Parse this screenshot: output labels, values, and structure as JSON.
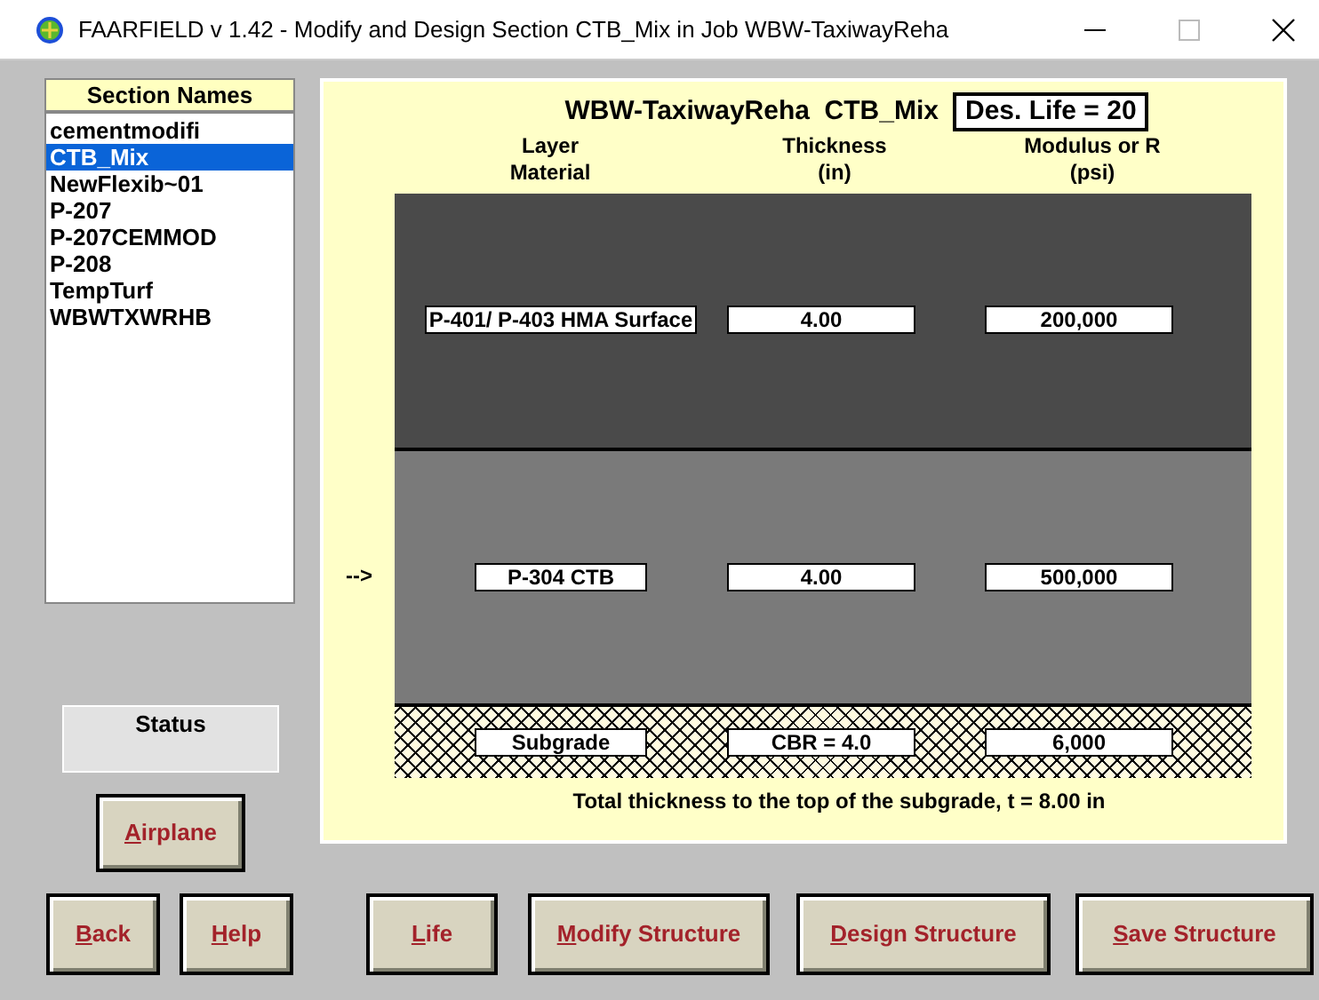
{
  "window": {
    "title": "FAARFIELD v 1.42 - Modify and Design Section CTB_Mix in Job WBW-TaxiwayReha"
  },
  "section_names": {
    "header": "Section Names",
    "items": [
      {
        "label": "cementmodifi",
        "selected": false
      },
      {
        "label": "CTB_Mix",
        "selected": true
      },
      {
        "label": "NewFlexib~01",
        "selected": false
      },
      {
        "label": "P-207",
        "selected": false
      },
      {
        "label": "P-207CEMMOD",
        "selected": false
      },
      {
        "label": "P-208",
        "selected": false
      },
      {
        "label": "TempTurf",
        "selected": false
      },
      {
        "label": "WBWTXWRHB",
        "selected": false
      }
    ]
  },
  "status": {
    "label": "Status"
  },
  "airplane_button": {
    "accel": "A",
    "rest": "irplane"
  },
  "structure": {
    "job": "WBW-TaxiwayReha",
    "section": "CTB_Mix",
    "design_life": "Des. Life = 20",
    "columns": [
      {
        "line1": "Layer",
        "line2": "Material"
      },
      {
        "line1": "Thickness",
        "line2": "(in)"
      },
      {
        "line1": "Modulus or R",
        "line2": "(psi)"
      }
    ],
    "layers": [
      {
        "kind": "surface",
        "material": "P-401/ P-403 HMA Surface",
        "thickness": "4.00",
        "modulus": "200,000"
      },
      {
        "kind": "base",
        "material": "P-304 CTB",
        "thickness": "4.00",
        "modulus": "500,000",
        "pointer": "-->"
      },
      {
        "kind": "subgrade",
        "material": "Subgrade",
        "thickness": "CBR = 4.0",
        "modulus": "6,000"
      }
    ],
    "total": "Total thickness to the top of the subgrade, t = 8.00 in"
  },
  "buttons": [
    {
      "accel": "B",
      "rest": "ack"
    },
    {
      "accel": "H",
      "rest": "elp"
    },
    {
      "accel": "L",
      "rest": "ife"
    },
    {
      "accel": "M",
      "rest": "odify Structure"
    },
    {
      "accel": "D",
      "rest": "esign Structure"
    },
    {
      "accel": "S",
      "rest": "ave Structure"
    }
  ]
}
